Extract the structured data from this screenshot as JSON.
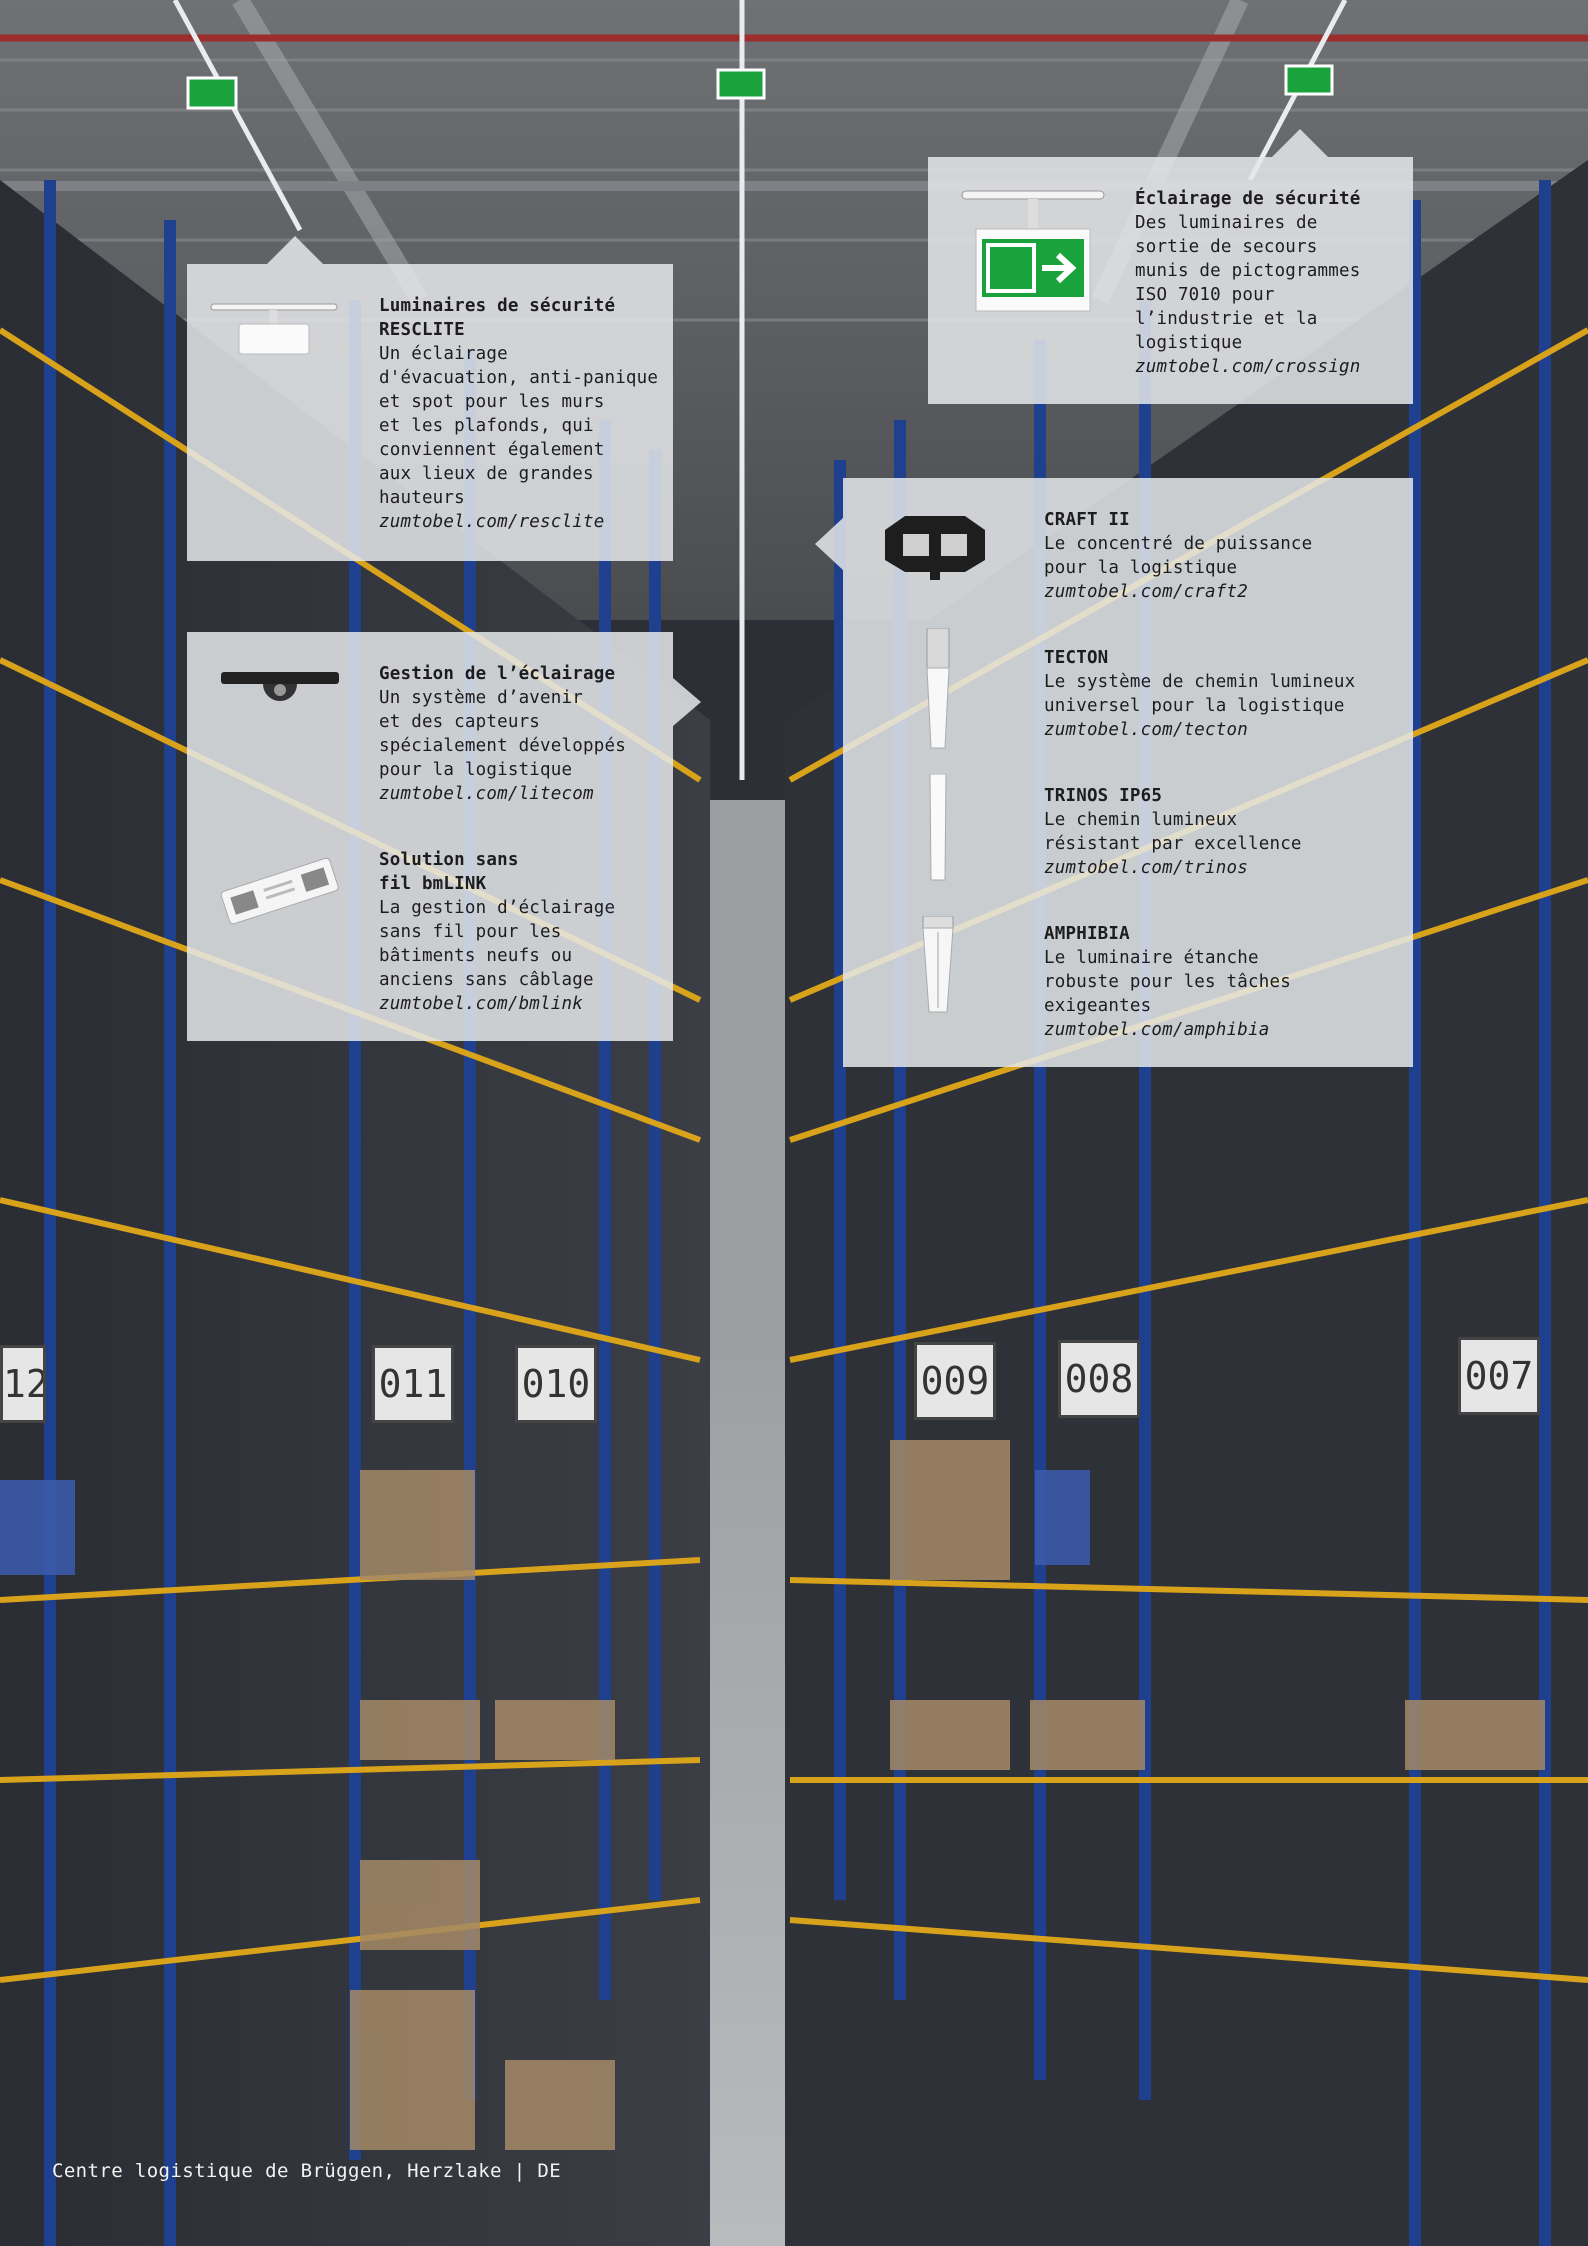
{
  "caption": "Centre logistique de Brüggen, Herzlake | DE",
  "rack_labels": [
    "12",
    "011",
    "010",
    "009",
    "008",
    "007"
  ],
  "panel_left_top": {
    "title": "Luminaires de sécurité\nRESCLITE",
    "description": "Un éclairage\nd'évacuation, anti-panique\net spot pour les murs\net les plafonds, qui\nconviennent également\naux lieux de grandes\nhauteurs",
    "url": "zumtobel.com/resclite",
    "icon": "emergency-light-icon"
  },
  "panel_right_top": {
    "title": "Éclairage de sécurité",
    "description": "Des luminaires de\nsortie de secours\nmunis de pictogrammes\nISO 7010 pour\nl’industrie et la\nlogistique",
    "url": "zumtobel.com/crossign",
    "icon": "exit-sign-icon"
  },
  "panel_left_mid": {
    "items": [
      {
        "title": "Gestion de l’éclairage",
        "description": "Un système d’avenir\net des capteurs\nspécialement développés\npour la logistique",
        "url": "zumtobel.com/litecom",
        "icon": "sensor-icon"
      },
      {
        "title": "Solution sans\nfil bmLINK",
        "description": "La gestion d’éclairage\nsans fil pour les\nbâtiments neufs ou\nanciens sans câblage",
        "url": "zumtobel.com/bmlink",
        "icon": "wireless-module-icon"
      }
    ]
  },
  "panel_right_mid": {
    "items": [
      {
        "title": "CRAFT II",
        "description": "Le concentré de puissance\npour la logistique",
        "url": "zumtobel.com/craft2",
        "icon": "high-bay-luminaire-icon"
      },
      {
        "title": "TECTON",
        "description": "Le système de chemin lumineux\nuniversel pour la logistique",
        "url": "zumtobel.com/tecton",
        "icon": "continuous-row-icon"
      },
      {
        "title": "TRINOS IP65",
        "description": "Le chemin lumineux\nrésistant par excellence",
        "url": "zumtobel.com/trinos",
        "icon": "linear-luminaire-icon"
      },
      {
        "title": "AMPHIBIA",
        "description": "Le luminaire étanche\nrobuste pour les tâches\nexigeantes",
        "url": "zumtobel.com/amphibia",
        "icon": "waterproof-luminaire-icon"
      }
    ]
  },
  "colors": {
    "rack_blue": "#1f3f8f",
    "beam_orange": "#d9a21b",
    "exit_green": "#1aa33c",
    "ceiling_red": "#9b2e2c"
  }
}
